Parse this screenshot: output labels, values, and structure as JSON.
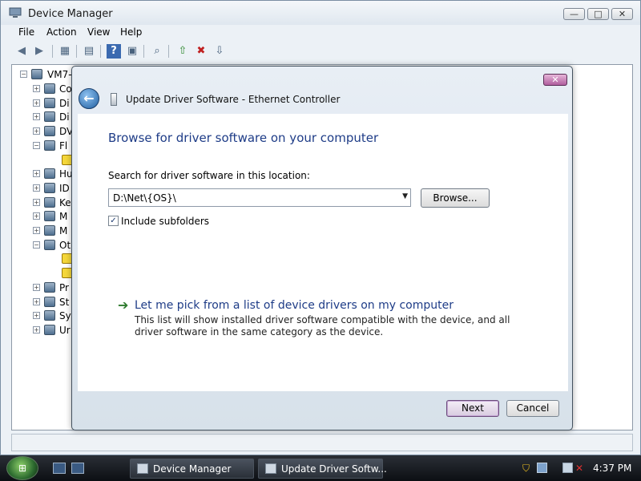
{
  "window": {
    "title": "Device Manager",
    "controls": {
      "minimize": "—",
      "maximize": "□",
      "close": "✕"
    }
  },
  "menu": [
    "File",
    "Action",
    "View",
    "Help"
  ],
  "toolbar": {
    "icons": [
      "back-icon",
      "forward-icon",
      "show-hide-tree-icon",
      "properties-icon",
      "help-icon",
      "view-icon",
      "scan-hardware-icon",
      "update-driver-icon",
      "disable-device-icon",
      "uninstall-device-icon"
    ]
  },
  "tree": {
    "root": "VM7-",
    "items": [
      "Co",
      "Di",
      "Di",
      "DV",
      "Fl",
      "",
      "Hu",
      "ID",
      "Ke",
      "M",
      "M",
      "Ot",
      "",
      "",
      "Pr",
      "St",
      "Sy",
      "Ur"
    ]
  },
  "dialog": {
    "title": "Update Driver Software - Ethernet Controller",
    "heading": "Browse for driver software on your computer",
    "search_label": "Search for driver software in this location:",
    "path_value": "D:\\Net\\{OS}\\",
    "browse_button": "Browse...",
    "include_subfolders": "Include subfolders",
    "include_subfolders_checked": true,
    "pick_link": "Let me pick from a list of device drivers on my computer",
    "pick_desc": "This list will show installed driver software compatible with the device, and all driver software in the same category as the device.",
    "next_button": "Next",
    "cancel_button": "Cancel",
    "close_glyph": "✕"
  },
  "taskbar": {
    "tasks": [
      "Device Manager",
      "Update Driver Softw..."
    ],
    "clock": "4:37 PM"
  }
}
